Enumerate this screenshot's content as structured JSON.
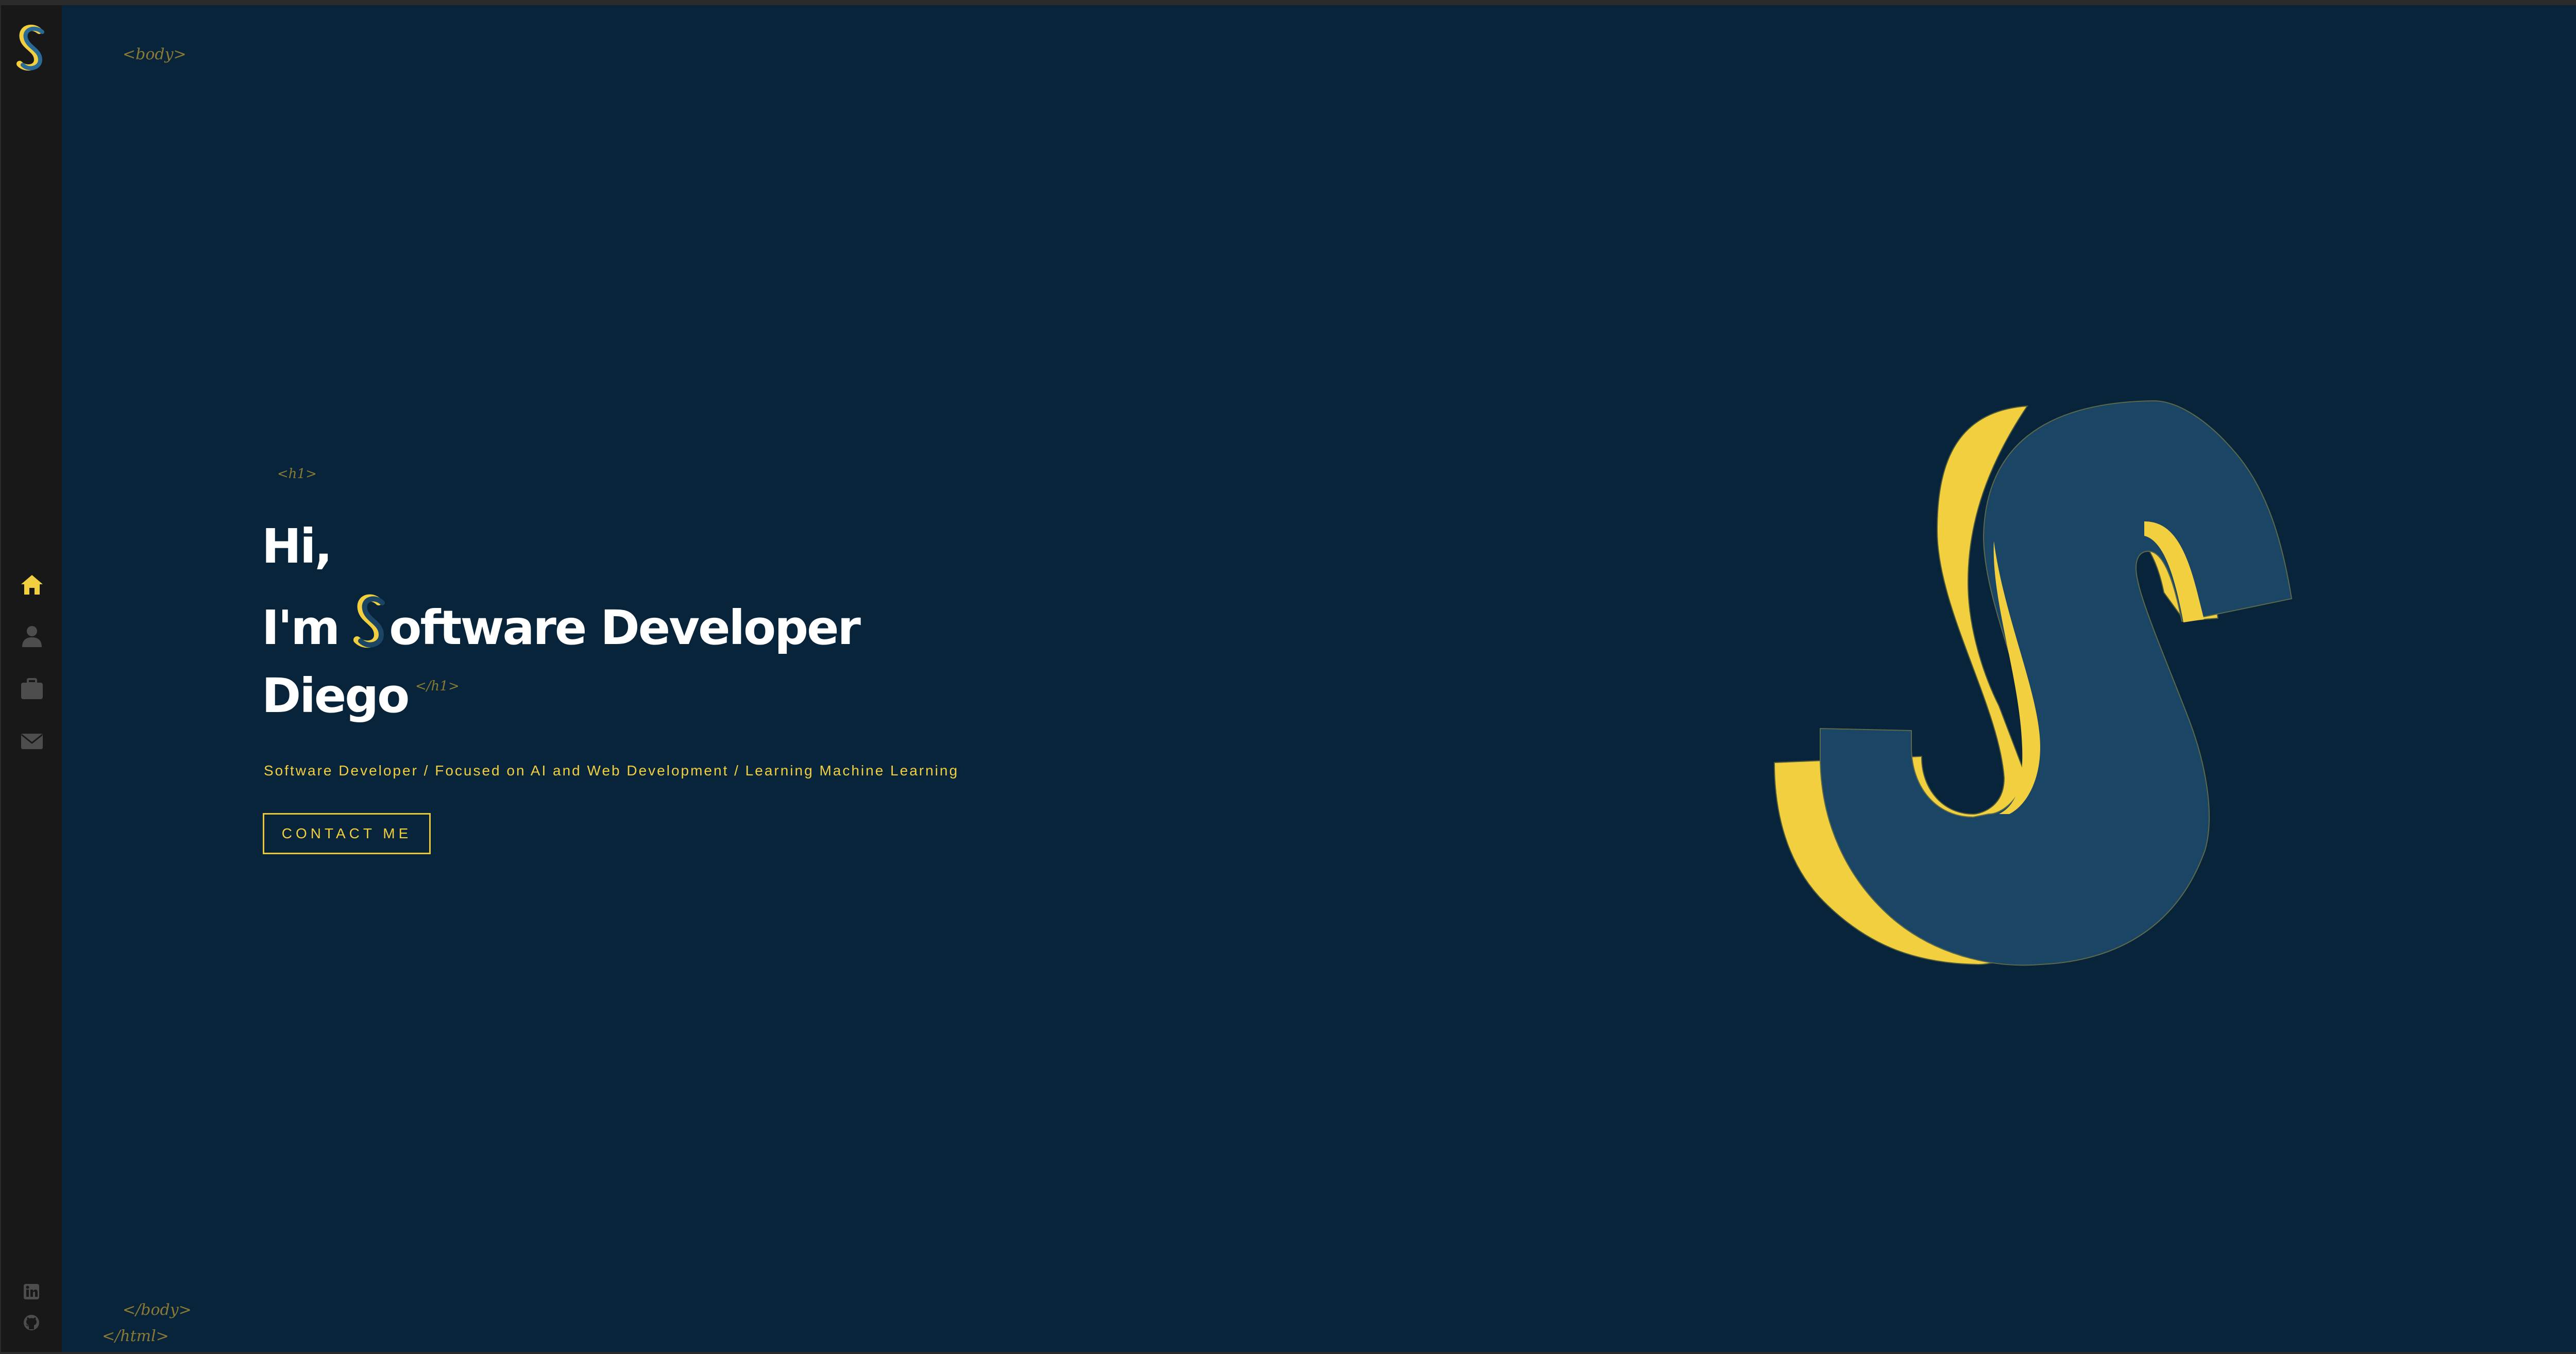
{
  "sidebar": {
    "logo_name": "s-logo",
    "nav_items": [
      {
        "name": "home",
        "icon": "home-icon",
        "active": true
      },
      {
        "name": "about",
        "icon": "user-icon",
        "active": false
      },
      {
        "name": "portfolio",
        "icon": "briefcase-icon",
        "active": false
      },
      {
        "name": "contact",
        "icon": "envelope-icon",
        "active": false
      }
    ],
    "social_links": [
      {
        "name": "linkedin",
        "icon": "linkedin-icon"
      },
      {
        "name": "github",
        "icon": "github-icon"
      }
    ]
  },
  "code_tags": {
    "body_open": "<body>",
    "h1_open": "<h1>",
    "h1_close": "</h1>",
    "body_close": "</body>",
    "html_close": "</html>"
  },
  "hero": {
    "line1": "Hi,",
    "line2_prefix": "I'm",
    "line2_suffix": "oftware Developer",
    "line3": "Diego",
    "subtitle": "Software Developer / Focused on AI and Web Development / Learning Machine Learning",
    "contact_button": "CONTACT ME"
  },
  "colors": {
    "background": "#08243a",
    "sidebar": "#181818",
    "accent_yellow": "#f2cf3f",
    "accent_blue": "#1a4564",
    "text": "#ffffff"
  }
}
